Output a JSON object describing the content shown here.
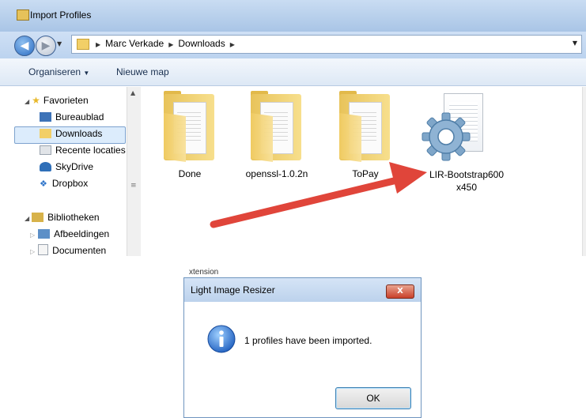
{
  "window": {
    "title": "Import Profiles",
    "breadcrumbs": [
      "Marc Verkade",
      "Downloads"
    ]
  },
  "toolbar": {
    "organize": "Organiseren",
    "new_folder": "Nieuwe map"
  },
  "nav": {
    "favorites": "Favorieten",
    "items": [
      "Bureaublad",
      "Downloads",
      "Recente locaties",
      "SkyDrive",
      "Dropbox"
    ],
    "libraries": "Bibliotheken",
    "library_items": [
      "Afbeeldingen",
      "Documenten"
    ],
    "selected": "Downloads"
  },
  "files": [
    {
      "name": "Done",
      "type": "folder"
    },
    {
      "name": "openssl-1.0.2n",
      "type": "folder"
    },
    {
      "name": "ToPay",
      "type": "folder"
    },
    {
      "name_line1": "LIR-Bootstrap600",
      "name_line2": "x450",
      "type": "config-file"
    }
  ],
  "background_text": "xtension",
  "dialog": {
    "title": "Light Image Resizer",
    "close": "X",
    "message": "1 profiles have been imported.",
    "ok": "OK"
  },
  "colors": {
    "arrow": "#e0453a",
    "selection": "#dcecfc",
    "title_bar": "#bcd2ec"
  },
  "icons": {
    "back": "arrow-left",
    "forward": "arrow-right",
    "favorites": "star",
    "info": "info"
  }
}
